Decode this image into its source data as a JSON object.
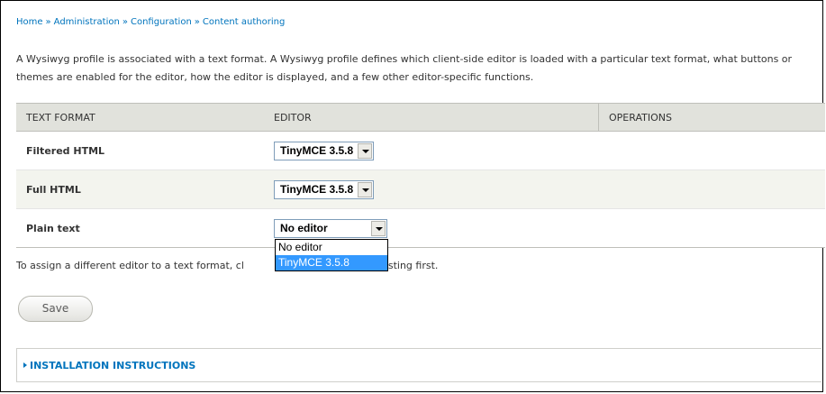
{
  "breadcrumb": [
    {
      "label": "Home"
    },
    {
      "label": "Administration"
    },
    {
      "label": "Configuration"
    },
    {
      "label": "Content authoring"
    }
  ],
  "breadcrumb_separator": "»",
  "help_text": "A Wysiwyg profile is associated with a text format. A Wysiwyg profile defines which client-side editor is loaded with a particular text format, what buttons or themes are enabled for the editor, how the editor is displayed, and a few other editor-specific functions.",
  "table": {
    "headers": {
      "format": "TEXT FORMAT",
      "editor": "EDITOR",
      "operations": "OPERATIONS"
    },
    "rows": [
      {
        "format": "Filtered HTML",
        "editor": "TinyMCE 3.5.8"
      },
      {
        "format": "Full HTML",
        "editor": "TinyMCE 3.5.8"
      },
      {
        "format": "Plain text",
        "editor": "No editor"
      }
    ]
  },
  "dropdown": {
    "options": [
      "No editor",
      "TinyMCE 3.5.8"
    ],
    "highlighted": "TinyMCE 3.5.8"
  },
  "hint": {
    "before": "To assign a different editor to a text format, cl",
    "after": "e the existing first."
  },
  "save_label": "Save",
  "fieldset_legend": "INSTALLATION INSTRUCTIONS",
  "colors": {
    "link": "#0074bd",
    "header_bg": "#e1e2dc",
    "selected_option": "#3399ff"
  }
}
